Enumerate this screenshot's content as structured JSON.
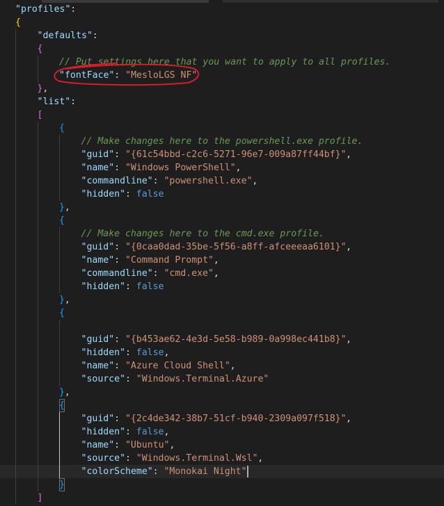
{
  "editor": {
    "lines": [
      {
        "segs": [
          {
            "t": "\"profiles\"",
            "c": "k"
          },
          {
            "t": ":",
            "c": "p"
          }
        ]
      },
      {
        "segs": [
          {
            "t": "{",
            "c": "b1"
          }
        ]
      },
      {
        "segs": [
          {
            "t": "\"defaults\"",
            "c": "k"
          },
          {
            "t": ":",
            "c": "p"
          }
        ]
      },
      {
        "segs": [
          {
            "t": "{",
            "c": "b2"
          }
        ]
      },
      {
        "segs": [
          {
            "t": "// Put settings here that you want to apply to all profiles.",
            "c": "c"
          }
        ]
      },
      {
        "segs": [
          {
            "t": "\"fontFace\"",
            "c": "k"
          },
          {
            "t": ": ",
            "c": "p"
          },
          {
            "t": "\"MesloLGS NF\"",
            "c": "s"
          }
        ]
      },
      {
        "segs": [
          {
            "t": "}",
            "c": "b2"
          },
          {
            "t": ",",
            "c": "p"
          }
        ]
      },
      {
        "segs": [
          {
            "t": "\"list\"",
            "c": "k"
          },
          {
            "t": ":",
            "c": "p"
          }
        ]
      },
      {
        "segs": [
          {
            "t": "[",
            "c": "b2"
          }
        ]
      },
      {
        "segs": [
          {
            "t": "{",
            "c": "b3"
          }
        ]
      },
      {
        "segs": [
          {
            "t": "// Make changes here to the powershell.exe profile.",
            "c": "c"
          }
        ]
      },
      {
        "segs": [
          {
            "t": "\"guid\"",
            "c": "k"
          },
          {
            "t": ": ",
            "c": "p"
          },
          {
            "t": "\"{61c54bbd-c2c6-5271-96e7-009a87ff44bf}\"",
            "c": "s"
          },
          {
            "t": ",",
            "c": "p"
          }
        ]
      },
      {
        "segs": [
          {
            "t": "\"name\"",
            "c": "k"
          },
          {
            "t": ": ",
            "c": "p"
          },
          {
            "t": "\"Windows PowerShell\"",
            "c": "s"
          },
          {
            "t": ",",
            "c": "p"
          }
        ]
      },
      {
        "segs": [
          {
            "t": "\"commandline\"",
            "c": "k"
          },
          {
            "t": ": ",
            "c": "p"
          },
          {
            "t": "\"powershell.exe\"",
            "c": "s"
          },
          {
            "t": ",",
            "c": "p"
          }
        ]
      },
      {
        "segs": [
          {
            "t": "\"hidden\"",
            "c": "k"
          },
          {
            "t": ": ",
            "c": "p"
          },
          {
            "t": "false",
            "c": "kw"
          }
        ]
      },
      {
        "segs": [
          {
            "t": "}",
            "c": "b3"
          },
          {
            "t": ",",
            "c": "p"
          }
        ]
      },
      {
        "segs": [
          {
            "t": "{",
            "c": "b3"
          }
        ]
      },
      {
        "segs": [
          {
            "t": "// Make changes here to the cmd.exe profile.",
            "c": "c"
          }
        ]
      },
      {
        "segs": [
          {
            "t": "\"guid\"",
            "c": "k"
          },
          {
            "t": ": ",
            "c": "p"
          },
          {
            "t": "\"{0caa0dad-35be-5f56-a8ff-afceeeaa6101}\"",
            "c": "s"
          },
          {
            "t": ",",
            "c": "p"
          }
        ]
      },
      {
        "segs": [
          {
            "t": "\"name\"",
            "c": "k"
          },
          {
            "t": ": ",
            "c": "p"
          },
          {
            "t": "\"Command Prompt\"",
            "c": "s"
          },
          {
            "t": ",",
            "c": "p"
          }
        ]
      },
      {
        "segs": [
          {
            "t": "\"commandline\"",
            "c": "k"
          },
          {
            "t": ": ",
            "c": "p"
          },
          {
            "t": "\"cmd.exe\"",
            "c": "s"
          },
          {
            "t": ",",
            "c": "p"
          }
        ]
      },
      {
        "segs": [
          {
            "t": "\"hidden\"",
            "c": "k"
          },
          {
            "t": ": ",
            "c": "p"
          },
          {
            "t": "false",
            "c": "kw"
          }
        ]
      },
      {
        "segs": [
          {
            "t": "}",
            "c": "b3"
          },
          {
            "t": ",",
            "c": "p"
          }
        ]
      },
      {
        "segs": [
          {
            "t": "{",
            "c": "b3"
          }
        ]
      },
      {
        "segs": []
      },
      {
        "segs": [
          {
            "t": "\"guid\"",
            "c": "k"
          },
          {
            "t": ": ",
            "c": "p"
          },
          {
            "t": "\"{b453ae62-4e3d-5e58-b989-0a998ec441b8}\"",
            "c": "s"
          },
          {
            "t": ",",
            "c": "p"
          }
        ]
      },
      {
        "segs": [
          {
            "t": "\"hidden\"",
            "c": "k"
          },
          {
            "t": ": ",
            "c": "p"
          },
          {
            "t": "false",
            "c": "kw"
          },
          {
            "t": ",",
            "c": "p"
          }
        ]
      },
      {
        "segs": [
          {
            "t": "\"name\"",
            "c": "k"
          },
          {
            "t": ": ",
            "c": "p"
          },
          {
            "t": "\"Azure Cloud Shell\"",
            "c": "s"
          },
          {
            "t": ",",
            "c": "p"
          }
        ]
      },
      {
        "segs": [
          {
            "t": "\"source\"",
            "c": "k"
          },
          {
            "t": ": ",
            "c": "p"
          },
          {
            "t": "\"Windows.Terminal.Azure\"",
            "c": "s"
          }
        ]
      },
      {
        "segs": [
          {
            "t": "}",
            "c": "b3"
          },
          {
            "t": ",",
            "c": "p"
          }
        ]
      },
      {
        "segs": [
          {
            "t": "{",
            "c": "b3"
          }
        ]
      },
      {
        "segs": [
          {
            "t": "\"guid\"",
            "c": "k"
          },
          {
            "t": ": ",
            "c": "p"
          },
          {
            "t": "\"{2c4de342-38b7-51cf-b940-2309a097f518}\"",
            "c": "s"
          },
          {
            "t": ",",
            "c": "p"
          }
        ]
      },
      {
        "segs": [
          {
            "t": "\"hidden\"",
            "c": "k"
          },
          {
            "t": ": ",
            "c": "p"
          },
          {
            "t": "false",
            "c": "kw"
          },
          {
            "t": ",",
            "c": "p"
          }
        ]
      },
      {
        "segs": [
          {
            "t": "\"name\"",
            "c": "k"
          },
          {
            "t": ": ",
            "c": "p"
          },
          {
            "t": "\"Ubuntu\"",
            "c": "s"
          },
          {
            "t": ",",
            "c": "p"
          }
        ]
      },
      {
        "segs": [
          {
            "t": "\"source\"",
            "c": "k"
          },
          {
            "t": ": ",
            "c": "p"
          },
          {
            "t": "\"Windows.Terminal.Wsl\"",
            "c": "s"
          },
          {
            "t": ",",
            "c": "p"
          }
        ]
      },
      {
        "segs": [
          {
            "t": "\"colorScheme\"",
            "c": "k"
          },
          {
            "t": ": ",
            "c": "p"
          },
          {
            "t": "\"Monokai Night\"",
            "c": "s"
          }
        ]
      },
      {
        "segs": [
          {
            "t": "}",
            "c": "b3"
          }
        ]
      },
      {
        "segs": [
          {
            "t": "]",
            "c": "b2"
          }
        ]
      },
      {
        "segs": [
          {
            "t": "}",
            "c": "b1"
          },
          {
            "t": ",",
            "c": "p"
          }
        ]
      }
    ]
  },
  "colors": {
    "background": "#1e1e1e",
    "key": "#9cdcfe",
    "string": "#ce9178",
    "comment": "#6a9955",
    "keyword": "#569cd6",
    "annotation": "#d0202a"
  },
  "annotation": {
    "shape": "hand-drawn-ellipse",
    "color": "#d0202a",
    "target_line": 5
  },
  "cursor": {
    "line": 35
  }
}
